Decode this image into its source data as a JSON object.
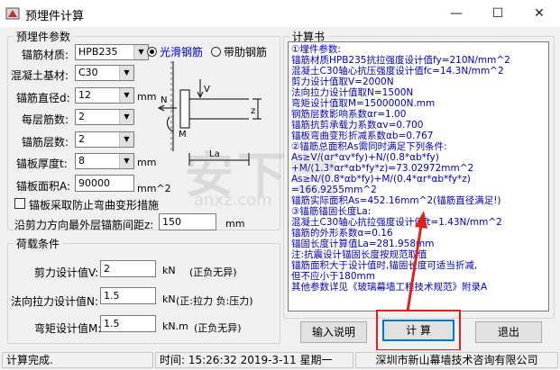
{
  "window": {
    "title": "预埋件计算",
    "min": "—",
    "max": "☐",
    "close": "✕"
  },
  "params": {
    "group_title": "预埋件参数",
    "anchor_material": {
      "label": "锚筋材质:",
      "value": "HPB235"
    },
    "concrete": {
      "label": "混凝土基材:",
      "value": "C30"
    },
    "anchor_dia": {
      "label": "锚筋直径d:",
      "value": "12",
      "unit": "mm"
    },
    "bars_per_layer": {
      "label": "每层筋数:",
      "value": "2"
    },
    "layers": {
      "label": "锚筋层数:",
      "value": "2"
    },
    "plate_thickness": {
      "label": "锚板厚度t:",
      "value": "8",
      "unit": "mm"
    },
    "plate_area": {
      "label": "锚板面积A:",
      "value": "90000",
      "unit": "mm^2"
    },
    "radio_smooth": "光滑钢筋",
    "radio_ribbed": "带肋钢筋",
    "check_label": "锚板采取防止弯曲变形措施",
    "min_spacing": {
      "label": "沿剪力方向最外层锚筋间距z:",
      "value": "150",
      "unit": "mm"
    }
  },
  "diagram": {
    "v": "V",
    "n": "N",
    "m": "M",
    "z": "z",
    "la": "La"
  },
  "loads": {
    "group_title": "荷载条件",
    "shear": {
      "label": "剪力设计值V:",
      "value": "2",
      "unit": "kN",
      "note": "(正负无异)"
    },
    "tension": {
      "label": "法向拉力设计值N:",
      "value": "1.5",
      "unit": "kN",
      "note": "(正:拉力 负:压力)"
    },
    "moment": {
      "label": "弯矩设计值M:",
      "value": "1.5",
      "unit": "kN.m",
      "note": "(正负无异)"
    }
  },
  "calc": {
    "group_title": "计算书",
    "lines": [
      "①埋件参数:",
      "锚筋材质HPB235抗拉强度设计值fy=210N/mm^2",
      "混凝土C30轴心抗压强度设计值fc=14.3N/mm^2",
      "剪力设计值取V=2000N",
      "法向拉力设计值取N=1500N",
      "弯矩设计值取M=1500000N.mm",
      "钢筋层数影响系数αr=1.00",
      "锚筋抗剪承载力系数αv=0.700",
      "锚板弯曲变形折减系数αb=0.767",
      "②锚筋总面积As需同时满足下列条件:",
      "As≥V/(αr*αv*fy)+N/(0.8*αb*fy)",
      "   +M/(1.3*αr*αb*fy*z)=73.02972mm^2",
      "As≥N/(0.8*αb*fy)+M/(0.4*αr*αb*fy*z)",
      "   =166.9255mm^2",
      "锚筋实际面积As=452.16mm^2(锚筋直径满足!)",
      "③锚筋锚固长度La:",
      "混凝土C30轴心抗拉强度设计值ft=1.43N/mm^2",
      "锚筋的外形系数α=0.16",
      "锚固长度计算值La=281.958mm",
      "注:抗震设计锚固长度按规范取值",
      "   锚筋面积大于设计值时,锚固长度可适当折减,",
      "   但不应小于180mm",
      "   其他参数详见《玻璃幕墙工程技术规范》附录A"
    ]
  },
  "buttons": {
    "help": "输入说明",
    "calc": "计 算",
    "exit": "退出"
  },
  "status": {
    "message": "计算完成.",
    "time": "时间: 15:26:32 2019-3-11 星期一",
    "company": "深圳市新山幕墙技术咨询有限公司"
  },
  "watermark": {
    "main": "安下载",
    "sub": "anxz.com"
  },
  "colors": {
    "calc_text": "#0000c8",
    "highlight": "#e0211b",
    "focus": "#0078d7"
  }
}
